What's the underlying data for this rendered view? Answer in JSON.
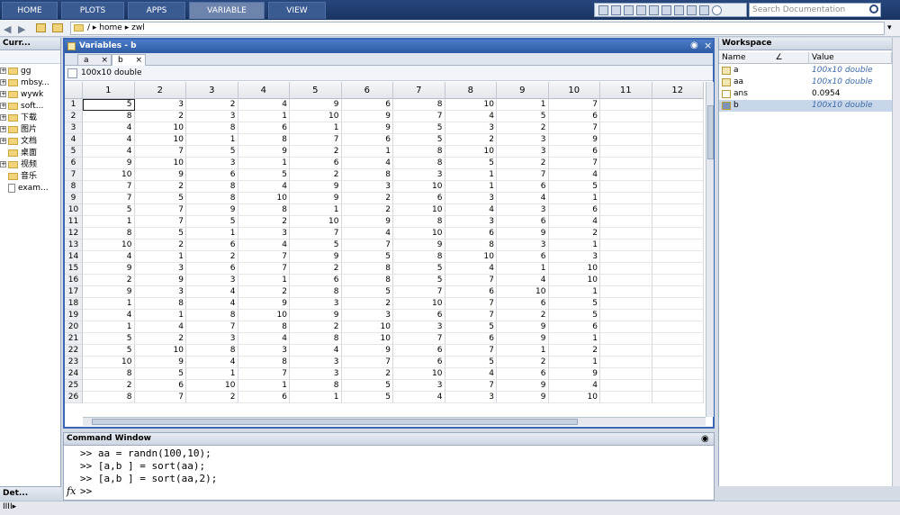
{
  "toolstrip": {
    "tabs": [
      {
        "label": "HOME"
      },
      {
        "label": "PLOTS"
      },
      {
        "label": "APPS"
      },
      {
        "label": "VARIABLE"
      },
      {
        "label": "VIEW"
      }
    ],
    "search_placeholder": "Search Documentation"
  },
  "address": {
    "root": "/",
    "sep": "▸",
    "segments": [
      "home",
      "zwl"
    ]
  },
  "current_folder": {
    "title": "Curr...",
    "items": [
      {
        "label": "gg",
        "expandable": true
      },
      {
        "label": "mbsy...",
        "expandable": true
      },
      {
        "label": "wywk",
        "expandable": true
      },
      {
        "label": "soft...",
        "expandable": true
      },
      {
        "label": "下载",
        "expandable": true
      },
      {
        "label": "图片",
        "expandable": true
      },
      {
        "label": "文档",
        "expandable": true
      },
      {
        "label": "桌面",
        "expandable": false
      },
      {
        "label": "视频",
        "expandable": true
      },
      {
        "label": "音乐",
        "expandable": false
      },
      {
        "label": "exam...",
        "expandable": false,
        "file": true
      }
    ]
  },
  "details_title": "Det...",
  "variables": {
    "title": "Variables - b",
    "tabs": [
      {
        "label": "a"
      },
      {
        "label": "b"
      }
    ],
    "info": "100x10 double",
    "columns": [
      "1",
      "2",
      "3",
      "4",
      "5",
      "6",
      "7",
      "8",
      "9",
      "10",
      "11",
      "12"
    ],
    "rows": [
      [
        "5",
        "3",
        "2",
        "4",
        "9",
        "6",
        "8",
        "10",
        "1",
        "7"
      ],
      [
        "8",
        "2",
        "3",
        "1",
        "10",
        "9",
        "7",
        "4",
        "5",
        "6"
      ],
      [
        "4",
        "10",
        "8",
        "6",
        "1",
        "9",
        "5",
        "3",
        "2",
        "7"
      ],
      [
        "4",
        "10",
        "1",
        "8",
        "7",
        "6",
        "5",
        "2",
        "3",
        "9"
      ],
      [
        "4",
        "7",
        "5",
        "9",
        "2",
        "1",
        "8",
        "10",
        "3",
        "6"
      ],
      [
        "9",
        "10",
        "3",
        "1",
        "6",
        "4",
        "8",
        "5",
        "2",
        "7"
      ],
      [
        "10",
        "9",
        "6",
        "5",
        "2",
        "8",
        "3",
        "1",
        "7",
        "4"
      ],
      [
        "7",
        "2",
        "8",
        "4",
        "9",
        "3",
        "10",
        "1",
        "6",
        "5"
      ],
      [
        "7",
        "5",
        "8",
        "10",
        "9",
        "2",
        "6",
        "3",
        "4",
        "1"
      ],
      [
        "5",
        "7",
        "9",
        "8",
        "1",
        "2",
        "10",
        "4",
        "3",
        "6"
      ],
      [
        "1",
        "7",
        "5",
        "2",
        "10",
        "9",
        "8",
        "3",
        "6",
        "4"
      ],
      [
        "8",
        "5",
        "1",
        "3",
        "7",
        "4",
        "10",
        "6",
        "9",
        "2"
      ],
      [
        "10",
        "2",
        "6",
        "4",
        "5",
        "7",
        "9",
        "8",
        "3",
        "1"
      ],
      [
        "4",
        "1",
        "2",
        "7",
        "9",
        "5",
        "8",
        "10",
        "6",
        "3"
      ],
      [
        "9",
        "3",
        "6",
        "7",
        "2",
        "8",
        "5",
        "4",
        "1",
        "10"
      ],
      [
        "2",
        "9",
        "3",
        "1",
        "6",
        "8",
        "5",
        "7",
        "4",
        "10"
      ],
      [
        "9",
        "3",
        "4",
        "2",
        "8",
        "5",
        "7",
        "6",
        "10",
        "1"
      ],
      [
        "1",
        "8",
        "4",
        "9",
        "3",
        "2",
        "10",
        "7",
        "6",
        "5"
      ],
      [
        "4",
        "1",
        "8",
        "10",
        "9",
        "3",
        "6",
        "7",
        "2",
        "5"
      ],
      [
        "1",
        "4",
        "7",
        "8",
        "2",
        "10",
        "3",
        "5",
        "9",
        "6"
      ],
      [
        "5",
        "2",
        "3",
        "4",
        "8",
        "10",
        "7",
        "6",
        "9",
        "1"
      ],
      [
        "5",
        "10",
        "8",
        "3",
        "4",
        "9",
        "6",
        "7",
        "1",
        "2"
      ],
      [
        "10",
        "9",
        "4",
        "8",
        "3",
        "7",
        "6",
        "5",
        "2",
        "1"
      ],
      [
        "8",
        "5",
        "1",
        "7",
        "3",
        "2",
        "10",
        "4",
        "6",
        "9"
      ],
      [
        "2",
        "6",
        "10",
        "1",
        "8",
        "5",
        "3",
        "7",
        "9",
        "4"
      ],
      [
        "8",
        "7",
        "2",
        "6",
        "1",
        "5",
        "4",
        "3",
        "9",
        "10"
      ]
    ]
  },
  "workspace": {
    "title": "Workspace",
    "headers": {
      "name": "Name",
      "sort": "∠",
      "value": "Value"
    },
    "vars": [
      {
        "name": "a",
        "value": "100x10 double"
      },
      {
        "name": "aa",
        "value": "100x10 double"
      },
      {
        "name": "ans",
        "value": "0.0954"
      },
      {
        "name": "b",
        "value": "100x10 double"
      }
    ]
  },
  "command_window": {
    "title": "Command Window",
    "lines": [
      ">> aa = randn(100,10);",
      ">> [a,b ] = sort(aa);",
      ">> [a,b ] = sort(aa,2);",
      ">>"
    ],
    "fx": "fx"
  },
  "status": {
    "text": "IIII▸"
  },
  "colors": {
    "accent": "#2d5aa3",
    "toolstrip": "#1a3461"
  }
}
